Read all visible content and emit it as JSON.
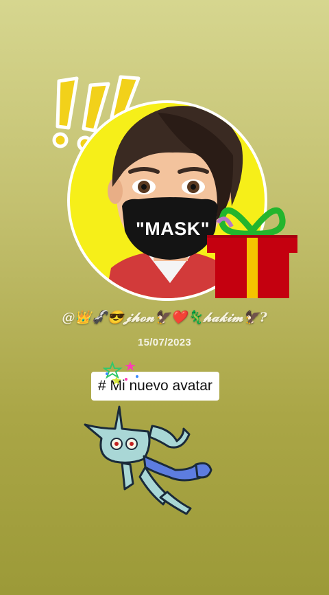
{
  "sticker": {
    "exclaim_icon": "exclamation-marks-icon"
  },
  "avatar": {
    "mask_text": "\"MASK\""
  },
  "gift": {
    "icon": "gift-box-icon"
  },
  "profile": {
    "username": "@👑🦨😎𝓳𝓱𝓸𝓷🦅❤️🦎𝓱𝓪𝓴𝓲𝓶🦅?",
    "date": "15/07/2023"
  },
  "caption": {
    "hashtag": "# Mi nuevo avatar"
  },
  "colors": {
    "background": "#c3c06f",
    "circle": "#f6ef19",
    "gift_box": "#c4000f",
    "gift_ribbon": "#f5c400",
    "bow": "#23b52d"
  }
}
